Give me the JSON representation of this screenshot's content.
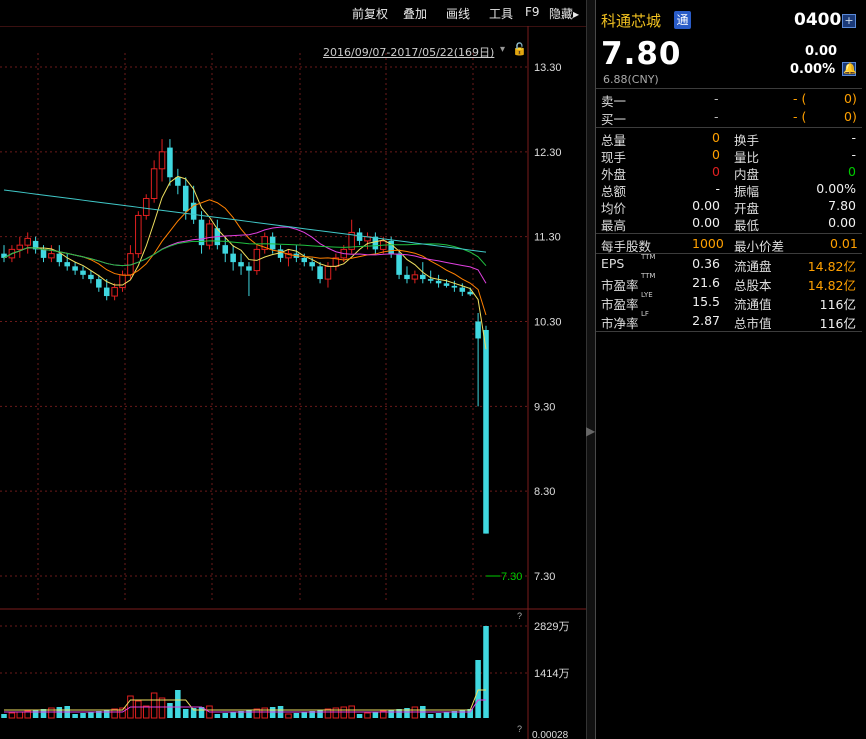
{
  "toolbar": {
    "items": [
      "前复权",
      "叠加",
      "画线",
      "工具",
      "F9",
      "隐藏▸"
    ],
    "range": "2016/09/07-2017/05/22(169日)"
  },
  "chart": {
    "price_ticks": [
      "13.30",
      "12.30",
      "11.30",
      "10.30",
      "9.30",
      "8.30",
      "7.30"
    ],
    "min_label": "7.30",
    "volume_ticks": [
      "2829万",
      "1414万",
      "0.00028"
    ],
    "question_marks": [
      "?",
      "?"
    ]
  },
  "quote": {
    "name": "科通芯城",
    "tag": "通",
    "code": "0400",
    "price": "7.80",
    "cny": "6.88(CNY)",
    "change": "0.00",
    "change_pct": "0.00%",
    "ask": {
      "label": "卖一",
      "price": "-",
      "vol": "- (",
      "vol2": "0)"
    },
    "bid": {
      "label": "买一",
      "price": "-",
      "vol": "- (",
      "vol2": "0)"
    },
    "stats": [
      {
        "l1": "总量",
        "v1": "0",
        "l2": "换手",
        "v2": "-"
      },
      {
        "l1": "现手",
        "v1": "0",
        "l2": "量比",
        "v2": "-"
      },
      {
        "l1": "外盘",
        "v1": "0",
        "l2": "内盘",
        "v2": "0"
      },
      {
        "l1": "总额",
        "v1": "-",
        "l2": "振幅",
        "v2": "0.00%"
      },
      {
        "l1": "均价",
        "v1": "0.00",
        "l2": "开盘",
        "v2": "7.80"
      },
      {
        "l1": "最高",
        "v1": "0.00",
        "l2": "最低",
        "v2": "0.00"
      }
    ],
    "lot": {
      "l1": "每手股数",
      "v1": "1000",
      "l2": "最小价差",
      "v2": "0.01"
    },
    "fundamentals": [
      {
        "l1": "EPS",
        "sup": "TTM",
        "v1": "0.36",
        "l2": "流通盘",
        "v2": "14.82亿"
      },
      {
        "l1": "市盈率",
        "sup": "TTM",
        "v1": "21.6",
        "l2": "总股本",
        "v2": "14.82亿"
      },
      {
        "l1": "市盈率",
        "sup": "LYE",
        "v1": "15.5",
        "l2": "流通值",
        "v2": "116亿"
      },
      {
        "l1": "市净率",
        "sup": "LF",
        "v1": "2.87",
        "l2": "总市值",
        "v2": "116亿"
      }
    ],
    "colors": {
      "up": "#e02020",
      "down": "#40d8e0",
      "accent": "#f0c020"
    }
  },
  "chart_data": {
    "type": "candlestick",
    "ylim": [
      7.3,
      13.3
    ],
    "candles": [
      [
        11.1,
        11.2,
        11.0,
        11.05
      ],
      [
        11.05,
        11.2,
        11.0,
        11.15
      ],
      [
        11.15,
        11.3,
        11.05,
        11.2
      ],
      [
        11.2,
        11.35,
        11.1,
        11.28
      ],
      [
        11.25,
        11.3,
        11.1,
        11.15
      ],
      [
        11.15,
        11.2,
        11.0,
        11.05
      ],
      [
        11.05,
        11.2,
        11.0,
        11.1
      ],
      [
        11.1,
        11.2,
        10.95,
        11.0
      ],
      [
        11.0,
        11.1,
        10.9,
        10.95
      ],
      [
        10.95,
        11.0,
        10.85,
        10.9
      ],
      [
        10.9,
        10.95,
        10.8,
        10.85
      ],
      [
        10.85,
        10.9,
        10.75,
        10.8
      ],
      [
        10.8,
        10.85,
        10.65,
        10.7
      ],
      [
        10.7,
        10.8,
        10.55,
        10.6
      ],
      [
        10.6,
        10.75,
        10.55,
        10.7
      ],
      [
        10.7,
        10.9,
        10.65,
        10.85
      ],
      [
        10.85,
        11.2,
        10.8,
        11.1
      ],
      [
        11.1,
        11.6,
        11.05,
        11.55
      ],
      [
        11.55,
        11.8,
        11.5,
        11.75
      ],
      [
        11.75,
        12.2,
        11.7,
        12.1
      ],
      [
        12.1,
        12.45,
        11.95,
        12.3
      ],
      [
        12.35,
        12.45,
        11.9,
        12.0
      ],
      [
        12.0,
        12.1,
        11.8,
        11.9
      ],
      [
        11.9,
        12.0,
        11.5,
        11.6
      ],
      [
        11.7,
        11.9,
        11.45,
        11.5
      ],
      [
        11.5,
        11.6,
        11.1,
        11.2
      ],
      [
        11.2,
        11.5,
        11.15,
        11.45
      ],
      [
        11.4,
        11.5,
        11.15,
        11.2
      ],
      [
        11.2,
        11.3,
        11.0,
        11.1
      ],
      [
        11.1,
        11.2,
        10.9,
        11.0
      ],
      [
        11.0,
        11.1,
        10.85,
        10.95
      ],
      [
        10.95,
        11.0,
        10.6,
        10.9
      ],
      [
        10.9,
        11.2,
        10.85,
        11.15
      ],
      [
        11.15,
        11.35,
        11.1,
        11.3
      ],
      [
        11.3,
        11.35,
        11.1,
        11.15
      ],
      [
        11.15,
        11.2,
        11.0,
        11.05
      ],
      [
        11.05,
        11.15,
        10.95,
        11.1
      ],
      [
        11.1,
        11.2,
        11.0,
        11.05
      ],
      [
        11.05,
        11.1,
        10.95,
        11.0
      ],
      [
        11.0,
        11.05,
        10.9,
        10.95
      ],
      [
        10.95,
        11.0,
        10.75,
        10.8
      ],
      [
        10.8,
        11.0,
        10.7,
        10.95
      ],
      [
        10.95,
        11.1,
        10.9,
        11.05
      ],
      [
        11.05,
        11.2,
        11.0,
        11.15
      ],
      [
        11.15,
        11.5,
        11.1,
        11.35
      ],
      [
        11.35,
        11.4,
        11.2,
        11.25
      ],
      [
        11.25,
        11.35,
        11.15,
        11.3
      ],
      [
        11.3,
        11.35,
        11.1,
        11.15
      ],
      [
        11.15,
        11.3,
        11.1,
        11.25
      ],
      [
        11.25,
        11.3,
        11.05,
        11.1
      ],
      [
        11.1,
        11.15,
        10.8,
        10.85
      ],
      [
        10.85,
        10.95,
        10.75,
        10.8
      ],
      [
        10.8,
        10.9,
        10.75,
        10.85
      ],
      [
        10.85,
        11.0,
        10.75,
        10.8
      ],
      [
        10.8,
        10.9,
        10.75,
        10.78
      ],
      [
        10.78,
        10.85,
        10.7,
        10.75
      ],
      [
        10.75,
        10.8,
        10.7,
        10.72
      ],
      [
        10.72,
        10.78,
        10.65,
        10.7
      ],
      [
        10.7,
        10.75,
        10.6,
        10.65
      ],
      [
        10.65,
        10.7,
        10.6,
        10.62
      ],
      [
        10.3,
        10.4,
        9.3,
        10.1
      ],
      [
        10.2,
        10.25,
        7.8,
        7.8
      ]
    ],
    "volume_max": 2829
  }
}
